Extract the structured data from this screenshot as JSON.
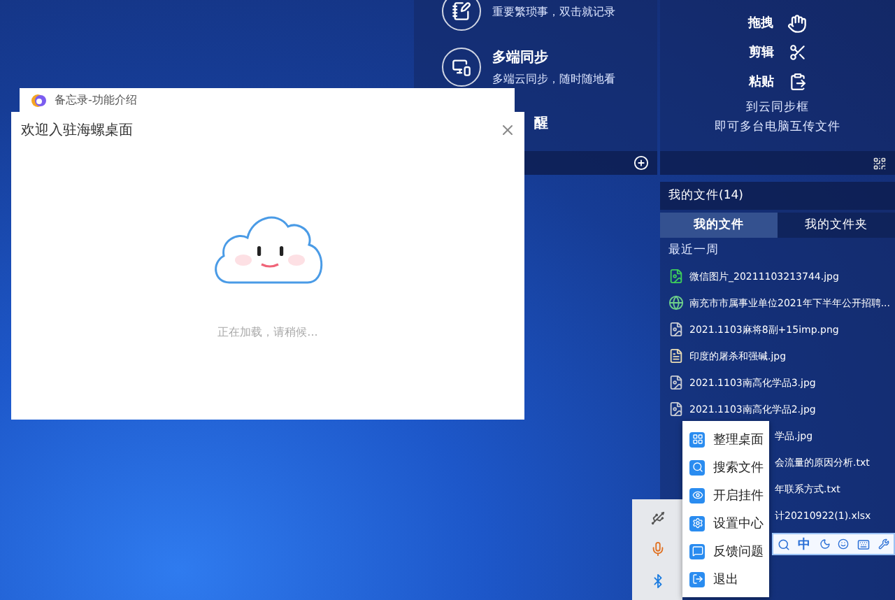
{
  "memo_panel": {
    "items": [
      {
        "kind": "note",
        "description": "重要繁琐事，双击就记录"
      },
      {
        "kind": "sync",
        "title": "多端同步",
        "description": "多端云同步，随时随地看"
      },
      {
        "kind": "hidden",
        "title": "醒"
      }
    ]
  },
  "transfer_panel": {
    "actions": [
      {
        "kind": "drag",
        "label": "拖拽"
      },
      {
        "kind": "cut",
        "label": "剪辑"
      },
      {
        "kind": "paste",
        "label": "粘贴"
      }
    ],
    "hint_lines": [
      "到云同步框",
      "即可多台电脑互传文件"
    ]
  },
  "files_panel": {
    "title": "我的文件(14)",
    "tabs": [
      {
        "label": "我的文件",
        "selected": true
      },
      {
        "label": "我的文件夹",
        "selected": false
      }
    ],
    "section": "最近一周",
    "files": [
      {
        "kind": "photo",
        "name": "微信图片_20211103213744.jpg",
        "partial": false
      },
      {
        "kind": "web",
        "name": "南充市市属事业单位2021年下半年公开招聘...",
        "partial": false
      },
      {
        "kind": "picture",
        "name": "2021.1103麻将8副+15imp.png",
        "partial": false
      },
      {
        "kind": "doc",
        "name": "印度的屠杀和强碱.jpg",
        "partial": false
      },
      {
        "kind": "picture",
        "name": "2021.1103南高化学品3.jpg",
        "partial": false
      },
      {
        "kind": "picture",
        "name": "2021.1103南高化学品2.jpg",
        "partial": false
      },
      {
        "name": "学品.jpg",
        "partial": true
      },
      {
        "name": "会流量的原因分析.txt",
        "partial": true
      },
      {
        "name": "年联系方式.txt",
        "partial": true
      },
      {
        "name": "计20210922(1).xlsx",
        "partial": true
      }
    ]
  },
  "context_menu": {
    "items": [
      {
        "kind": "tidy",
        "label": "整理桌面"
      },
      {
        "kind": "search",
        "label": "搜索文件"
      },
      {
        "kind": "widget",
        "label": "开启挂件"
      },
      {
        "kind": "settings",
        "label": "设置中心"
      },
      {
        "kind": "feedback",
        "label": "反馈问题"
      },
      {
        "kind": "exit",
        "label": "退出"
      }
    ]
  },
  "ime_bar": {
    "mode": "中"
  },
  "dialog": {
    "title": "备忘录-功能介绍",
    "heading": "欢迎入驻海螺桌面",
    "status": "正在加载，请稍候..."
  }
}
